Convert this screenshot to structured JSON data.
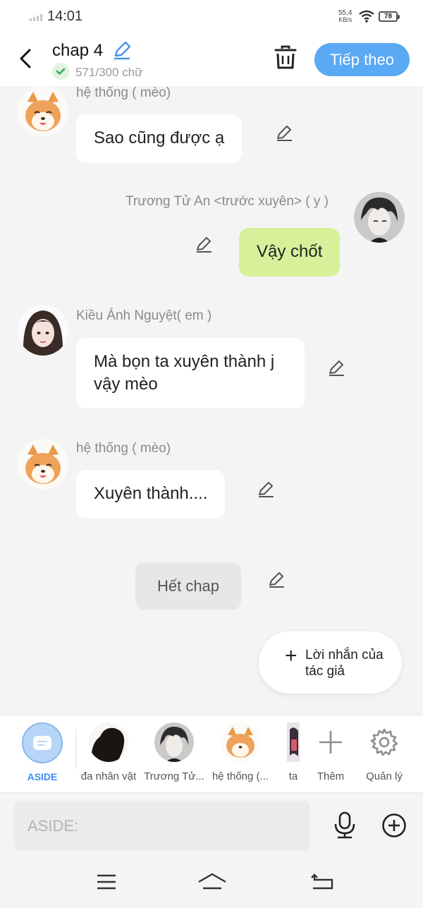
{
  "status_bar": {
    "time": "14:01",
    "speed_value": "55,4",
    "speed_unit": "KB/s",
    "battery": "78"
  },
  "header": {
    "title": "chap 4",
    "word_count": "571/300 chữ",
    "next_label": "Tiếp theo"
  },
  "messages": [
    {
      "sender": "hệ thống ( mèo)",
      "text": "Sao cũng được ạ",
      "side": "left"
    },
    {
      "sender": "Trương Tử An <trước xuyên> ( y )",
      "text": "Vậy chốt",
      "side": "right"
    },
    {
      "sender": "Kiều Ánh Nguyệt( em )",
      "text": "Mà bọn ta xuyên thành j vậy mèo",
      "side": "left"
    },
    {
      "sender": "hệ thống ( mèo)",
      "text": "Xuyên thành....",
      "side": "left"
    }
  ],
  "end_label": "Hết chap",
  "author_note": {
    "plus": "+",
    "label": "Lời nhắn của tác giả"
  },
  "characters": {
    "aside": "ASIDE",
    "items": [
      "đa nhân vật",
      "Trương Tử...",
      "hệ thống (...",
      "ta"
    ],
    "add_label": "Thêm",
    "manage_label": "Quản lý"
  },
  "input": {
    "placeholder": "ASIDE:"
  },
  "colors": {
    "accent": "#5aa9f5",
    "right_bubble": "#d7f19a",
    "aside_blue": "#3b8df0"
  }
}
